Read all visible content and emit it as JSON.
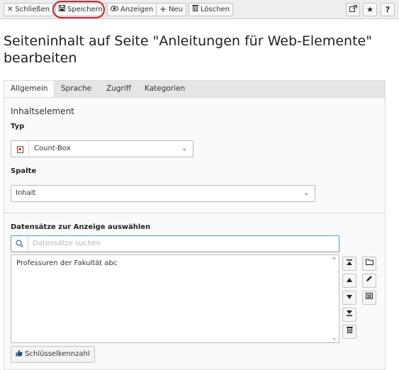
{
  "toolbar": {
    "close_label": "Schließen",
    "save_label": "Speichern",
    "view_label": "Anzeigen",
    "new_label": "Neu",
    "delete_label": "Löschen",
    "icons": {
      "close": "close-icon",
      "save": "floppy-disk-icon",
      "view": "eye-icon",
      "new": "plus-icon",
      "delete": "trash-icon",
      "open_new_window": "external-window-icon",
      "bookmark": "star-icon",
      "help": "question-icon"
    },
    "help_glyph": "?"
  },
  "page_title": "Seiteninhalt auf Seite \"Anleitungen für Web-Elemente\" bearbeiten",
  "tabs": [
    {
      "label": "Allgemein",
      "active": true
    },
    {
      "label": "Sprache",
      "active": false
    },
    {
      "label": "Zugriff",
      "active": false
    },
    {
      "label": "Kategorien",
      "active": false
    }
  ],
  "form": {
    "section_heading": "Inhaltselement",
    "type": {
      "label": "Typ",
      "value": "Count-Box",
      "icon": "content-element-icon"
    },
    "column": {
      "label": "Spalte",
      "value": "Inhalt"
    },
    "records": {
      "label": "Datensätze zur Anzeige auswählen",
      "search_placeholder": "Datensätze suchen",
      "items": [
        "Professuren der Fakultät abc"
      ]
    },
    "list_controls": {
      "move_top": "move-to-top-icon",
      "move_up": "move-up-icon",
      "move_down": "move-down-icon",
      "move_bottom": "move-to-bottom-icon",
      "remove": "trash-icon",
      "browse": "folder-icon",
      "edit": "pencil-icon",
      "list": "list-icon"
    },
    "key_figure_button": "Schlüsselkennzahl"
  },
  "colors": {
    "toolbar_bg": "#eeeeee",
    "highlight": "#d0202a",
    "search_border": "#5f9fd6"
  }
}
